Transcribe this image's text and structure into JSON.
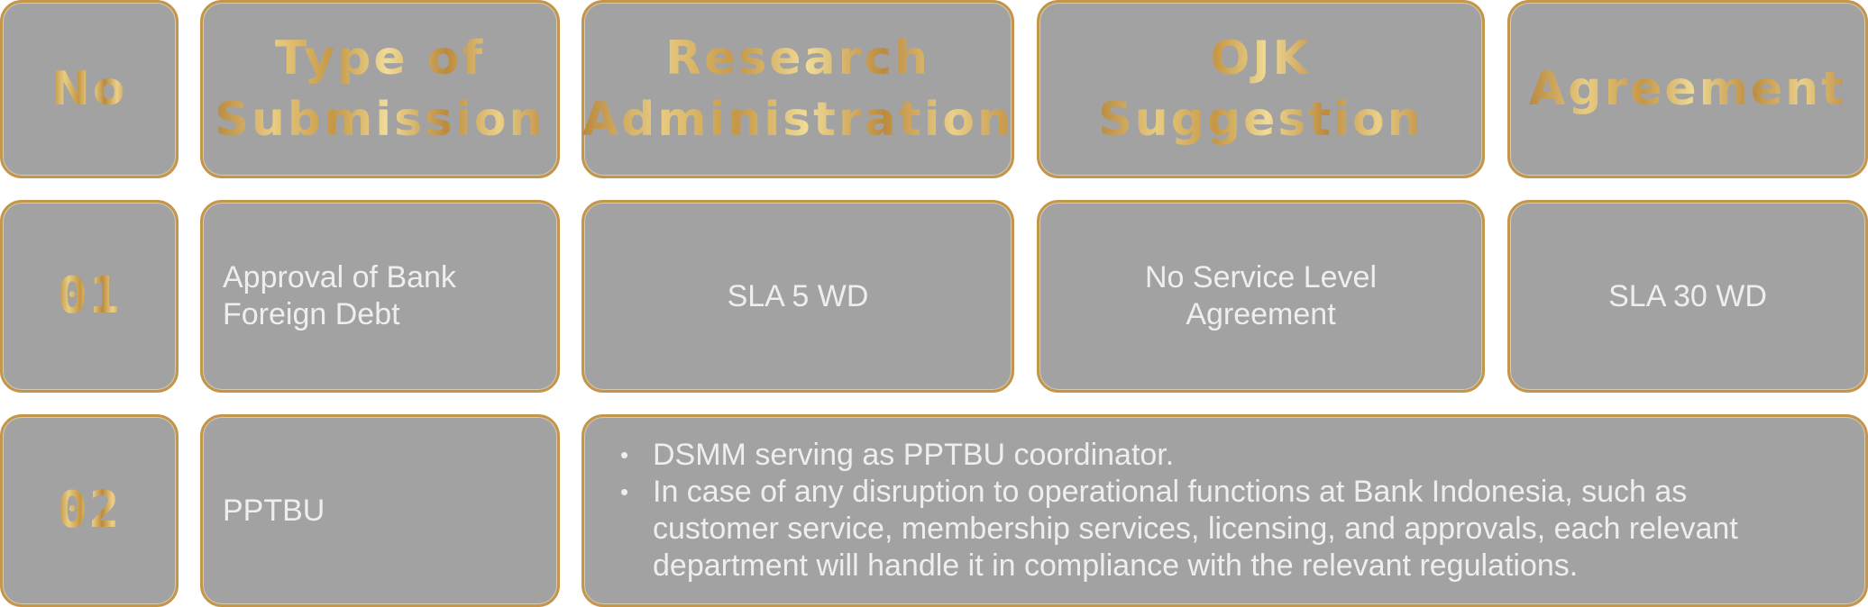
{
  "headers": {
    "no": "No",
    "type_line1": "Type of",
    "type_line2": "Submission",
    "research_line1": "Research",
    "research_line2": "Administration",
    "ojk_line1": "OJK",
    "ojk_line2": "Suggestion",
    "agreement": "Agreement"
  },
  "rows": [
    {
      "no": "01",
      "type_line1": "Approval of Bank",
      "type_line2": "Foreign Debt",
      "research": "SLA 5 WD",
      "ojk_line1": "No Service Level",
      "ojk_line2": "Agreement",
      "agreement": "SLA 30 WD"
    },
    {
      "no": "02",
      "type": "PPTBU",
      "bullet_char": "•",
      "note_1": "DSMM serving as PPTBU coordinator.",
      "note_2_line1": "In case of any disruption to operational functions at Bank Indonesia, such as",
      "note_2_line2": "customer service, membership services, licensing, and approvals, each relevant",
      "note_2_line3": "department will handle it in compliance with the relevant regulations."
    }
  ],
  "colors": {
    "cell_background": "#a2a2a2",
    "gold_border": "#c4954a",
    "body_text": "#eeeeee"
  }
}
